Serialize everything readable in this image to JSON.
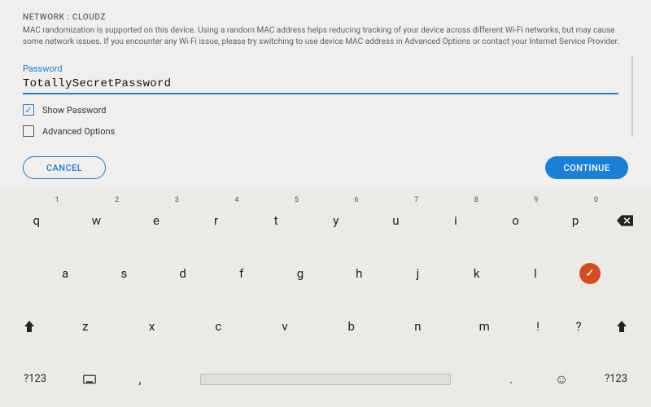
{
  "breadcrumb": {
    "prefix": "NETWORK",
    "sep": ":",
    "name": "CLOUDZ"
  },
  "info_text": "MAC randomization is supported on this device. Using a random MAC address helps reducing tracking of your device across different Wi-Fi networks, but may cause some network issues. If you encounter any Wi-Fi issue, please try switching to use device MAC address in Advanced Options or contact your Internet Service Provider.",
  "password": {
    "label": "Password",
    "value": "TotallySecretPassword"
  },
  "checkboxes": {
    "show_password": {
      "label": "Show Password",
      "checked": true
    },
    "advanced_options": {
      "label": "Advanced Options",
      "checked": false
    }
  },
  "buttons": {
    "cancel": "CANCEL",
    "continue": "CONTINUE"
  },
  "keyboard": {
    "row1": [
      {
        "main": "q",
        "hint": "1"
      },
      {
        "main": "w",
        "hint": "2"
      },
      {
        "main": "e",
        "hint": "3"
      },
      {
        "main": "r",
        "hint": "4"
      },
      {
        "main": "t",
        "hint": "5"
      },
      {
        "main": "y",
        "hint": "6"
      },
      {
        "main": "u",
        "hint": "7"
      },
      {
        "main": "i",
        "hint": "8"
      },
      {
        "main": "o",
        "hint": "9"
      },
      {
        "main": "p",
        "hint": "0"
      }
    ],
    "row2": [
      "a",
      "s",
      "d",
      "f",
      "g",
      "h",
      "j",
      "k",
      "l"
    ],
    "row3": [
      "z",
      "x",
      "c",
      "v",
      "b",
      "n",
      "m"
    ],
    "punct": {
      "excl": "!",
      "ques": "?"
    },
    "row4": {
      "mode": "?123",
      "comma": ",",
      "period": "."
    }
  }
}
